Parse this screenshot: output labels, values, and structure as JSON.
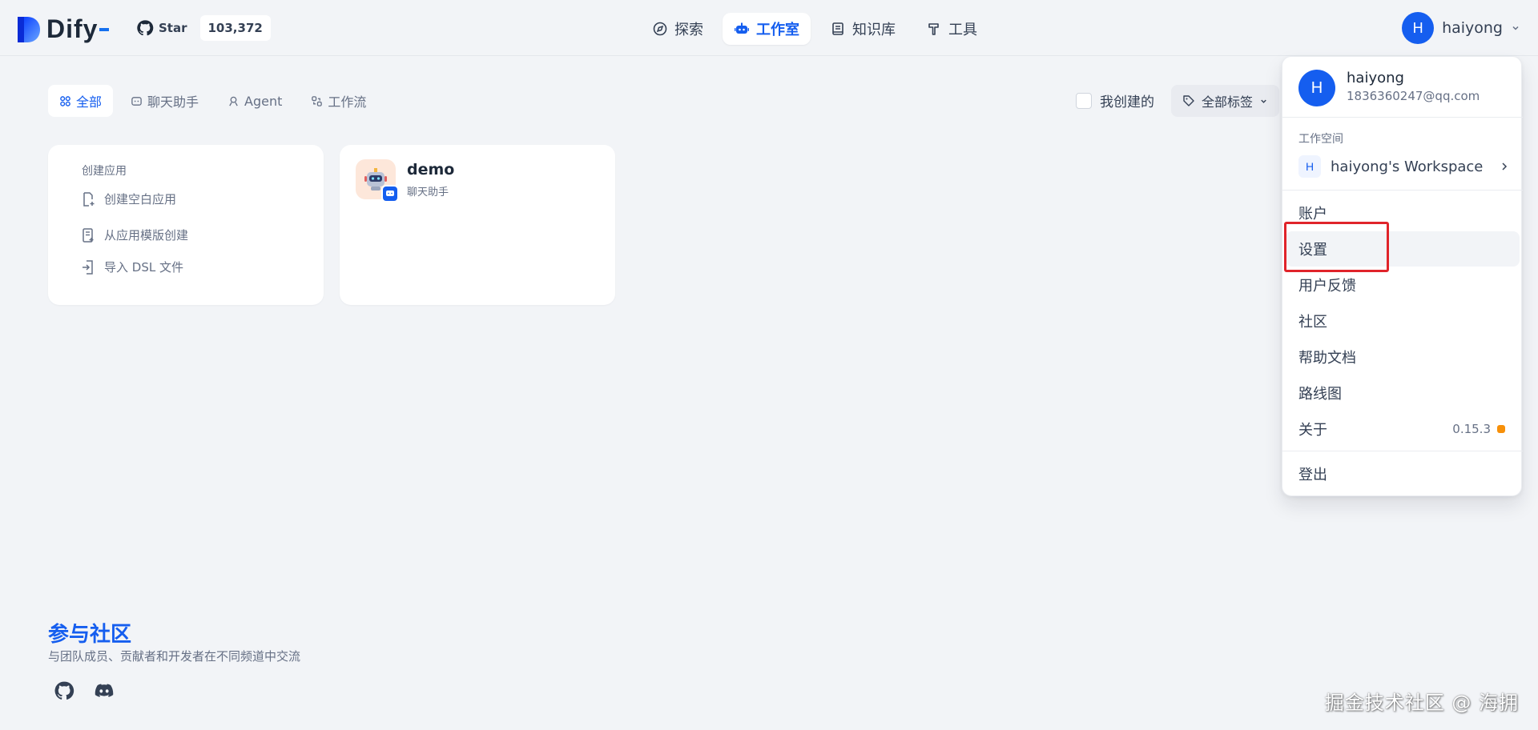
{
  "header": {
    "brand": "Dify",
    "github": {
      "star_label": "Star",
      "star_count": "103,372"
    },
    "nav": [
      {
        "label": "探索",
        "icon": "compass-icon"
      },
      {
        "label": "工作室",
        "icon": "robot-icon",
        "active": true
      },
      {
        "label": "知识库",
        "icon": "book-icon"
      },
      {
        "label": "工具",
        "icon": "hammer-icon"
      }
    ],
    "user": {
      "initial": "H",
      "name": "haiyong"
    }
  },
  "filters": {
    "tabs": [
      {
        "label": "全部",
        "icon": "grid-icon",
        "active": true
      },
      {
        "label": "聊天助手",
        "icon": "chat-icon"
      },
      {
        "label": "Agent",
        "icon": "agent-icon"
      },
      {
        "label": "工作流",
        "icon": "workflow-icon"
      }
    ],
    "mine_label": "我创建的",
    "tag_label": "全部标签"
  },
  "create_card": {
    "title": "创建应用",
    "items": [
      "创建空白应用",
      "从应用模版创建",
      "导入 DSL 文件"
    ]
  },
  "apps": [
    {
      "name": "demo",
      "type": "聊天助手"
    }
  ],
  "community": {
    "title": "参与社区",
    "desc": "与团队成员、贡献者和开发者在不同频道中交流"
  },
  "dropdown": {
    "initial": "H",
    "name": "haiyong",
    "email": "1836360247@qq.com",
    "workspace_label": "工作空间",
    "workspace_initial": "H",
    "workspace_name": "haiyong's Workspace",
    "items": [
      "账户",
      "设置",
      "用户反馈",
      "社区",
      "帮助文档",
      "路线图",
      "关于"
    ],
    "version": "0.15.3",
    "logout": "登出"
  },
  "watermark": "掘金技术社区 @ 海拥",
  "colors": {
    "accent": "#155eef",
    "highlight": "#e0242a",
    "version_dot": "#f79009"
  }
}
